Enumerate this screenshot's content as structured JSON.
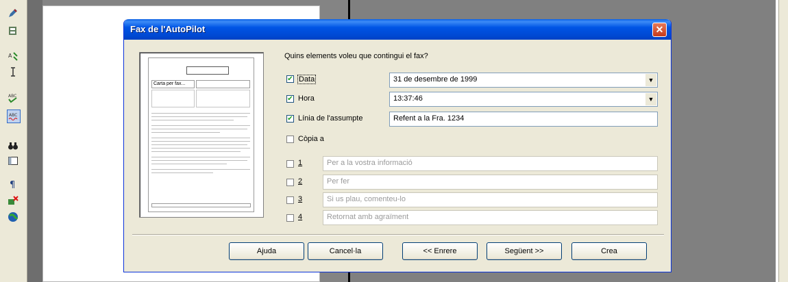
{
  "dialog": {
    "title": "Fax de l'AutoPilot",
    "close_glyph": "✕",
    "question": "Quins elements voleu que contingui el fax?",
    "options": [
      {
        "label": "Data",
        "checked": true,
        "value": "31 de desembre de 1999",
        "combo": true
      },
      {
        "label": "Hora",
        "checked": true,
        "value": "13:37:46",
        "combo": true
      },
      {
        "label": "Línia de l'assumpte",
        "checked": true,
        "value": "Refent a la Fra. 1234",
        "combo": false
      },
      {
        "label": "Còpia a",
        "checked": false
      }
    ],
    "numbered": [
      {
        "label": "1",
        "value": "Per a la vostra informació"
      },
      {
        "label": "2",
        "value": "Per fer"
      },
      {
        "label": "3",
        "value": "Si us plau, comenteu-lo"
      },
      {
        "label": "4",
        "value": "Retornat amb agraïment"
      }
    ],
    "preview_text": "Carta per fax...",
    "buttons": {
      "help": "Ajuda",
      "cancel": "Cancel·la",
      "back": "<< Enrere",
      "next": "Següent >>",
      "create": "Crea"
    }
  },
  "toolbar_icons": [
    "pencil-icon",
    "gallery-icon",
    "autospell-icon",
    "text-cursor-icon",
    "spellcheck-icon",
    "autospellcheck-icon",
    "binoculars-icon",
    "navigator-icon",
    "paragraph-icon",
    "delete-icon",
    "globe-icon"
  ]
}
